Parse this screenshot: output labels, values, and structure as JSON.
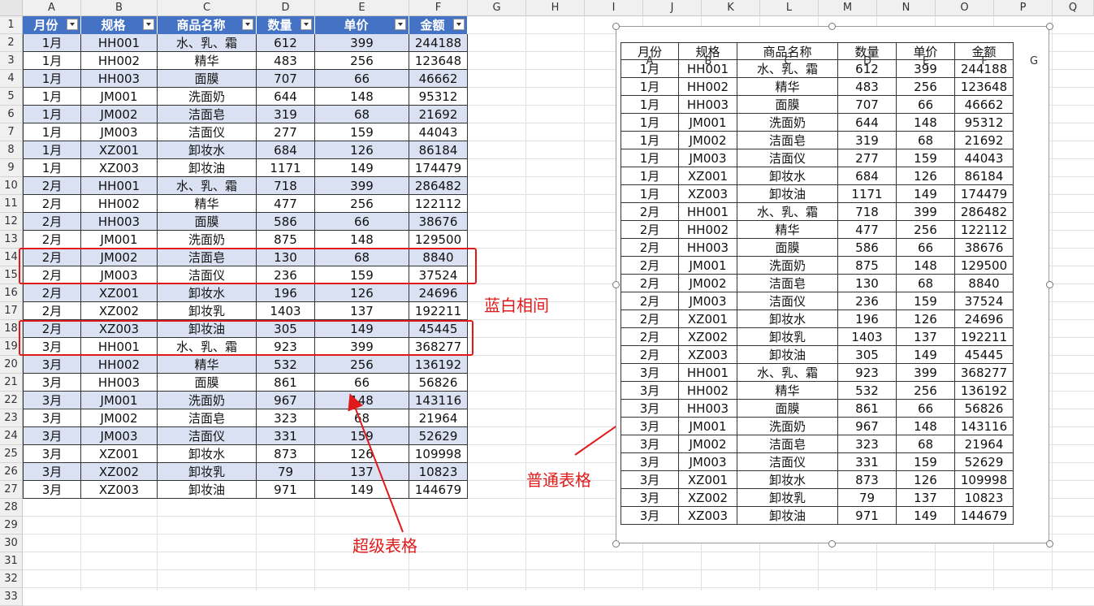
{
  "column_letters": [
    "A",
    "B",
    "C",
    "D",
    "E",
    "F",
    "G",
    "H",
    "I",
    "J",
    "K",
    "L",
    "M",
    "N",
    "O",
    "P",
    "Q"
  ],
  "row_numbers": [
    "1",
    "2",
    "3",
    "4",
    "5",
    "6",
    "7",
    "8",
    "9",
    "10",
    "11",
    "12",
    "13",
    "14",
    "15",
    "16",
    "17",
    "18",
    "19",
    "20",
    "21",
    "22",
    "23",
    "24",
    "25",
    "26",
    "27",
    "28",
    "29",
    "30",
    "31",
    "32",
    "33"
  ],
  "headers": [
    "月份",
    "规格",
    "商品名称",
    "数量",
    "单价",
    "金额"
  ],
  "rows": [
    [
      "1月",
      "HH001",
      "水、乳、霜",
      "612",
      "399",
      "244188"
    ],
    [
      "1月",
      "HH002",
      "精华",
      "483",
      "256",
      "123648"
    ],
    [
      "1月",
      "HH003",
      "面膜",
      "707",
      "66",
      "46662"
    ],
    [
      "1月",
      "JM001",
      "洗面奶",
      "644",
      "148",
      "95312"
    ],
    [
      "1月",
      "JM002",
      "洁面皂",
      "319",
      "68",
      "21692"
    ],
    [
      "1月",
      "JM003",
      "洁面仪",
      "277",
      "159",
      "44043"
    ],
    [
      "1月",
      "XZ001",
      "卸妆水",
      "684",
      "126",
      "86184"
    ],
    [
      "1月",
      "XZ003",
      "卸妆油",
      "1171",
      "149",
      "174479"
    ],
    [
      "2月",
      "HH001",
      "水、乳、霜",
      "718",
      "399",
      "286482"
    ],
    [
      "2月",
      "HH002",
      "精华",
      "477",
      "256",
      "122112"
    ],
    [
      "2月",
      "HH003",
      "面膜",
      "586",
      "66",
      "38676"
    ],
    [
      "2月",
      "JM001",
      "洗面奶",
      "875",
      "148",
      "129500"
    ],
    [
      "2月",
      "JM002",
      "洁面皂",
      "130",
      "68",
      "8840"
    ],
    [
      "2月",
      "JM003",
      "洁面仪",
      "236",
      "159",
      "37524"
    ],
    [
      "2月",
      "XZ001",
      "卸妆水",
      "196",
      "126",
      "24696"
    ],
    [
      "2月",
      "XZ002",
      "卸妆乳",
      "1403",
      "137",
      "192211"
    ],
    [
      "2月",
      "XZ003",
      "卸妆油",
      "305",
      "149",
      "45445"
    ],
    [
      "3月",
      "HH001",
      "水、乳、霜",
      "923",
      "399",
      "368277"
    ],
    [
      "3月",
      "HH002",
      "精华",
      "532",
      "256",
      "136192"
    ],
    [
      "3月",
      "HH003",
      "面膜",
      "861",
      "66",
      "56826"
    ],
    [
      "3月",
      "JM001",
      "洗面奶",
      "967",
      "148",
      "143116"
    ],
    [
      "3月",
      "JM002",
      "洁面皂",
      "323",
      "68",
      "21964"
    ],
    [
      "3月",
      "JM003",
      "洁面仪",
      "331",
      "159",
      "52629"
    ],
    [
      "3月",
      "XZ001",
      "卸妆水",
      "873",
      "126",
      "109998"
    ],
    [
      "3月",
      "XZ002",
      "卸妆乳",
      "79",
      "137",
      "10823"
    ],
    [
      "3月",
      "XZ003",
      "卸妆油",
      "971",
      "149",
      "144679"
    ]
  ],
  "picture_col_letters": [
    "A",
    "B",
    "C",
    "D",
    "E",
    "F",
    "G"
  ],
  "annotations": {
    "banded": "蓝白相间",
    "plain_table": "普通表格",
    "super_table": "超级表格"
  },
  "colors": {
    "header_fill": "#4472c4",
    "band_fill": "#d9e1f2",
    "annotation": "#e01a1a",
    "grid": "#e1e1e1"
  },
  "icons": {
    "filter": "filter-dropdown-icon",
    "handle": "resize-handle-icon"
  }
}
